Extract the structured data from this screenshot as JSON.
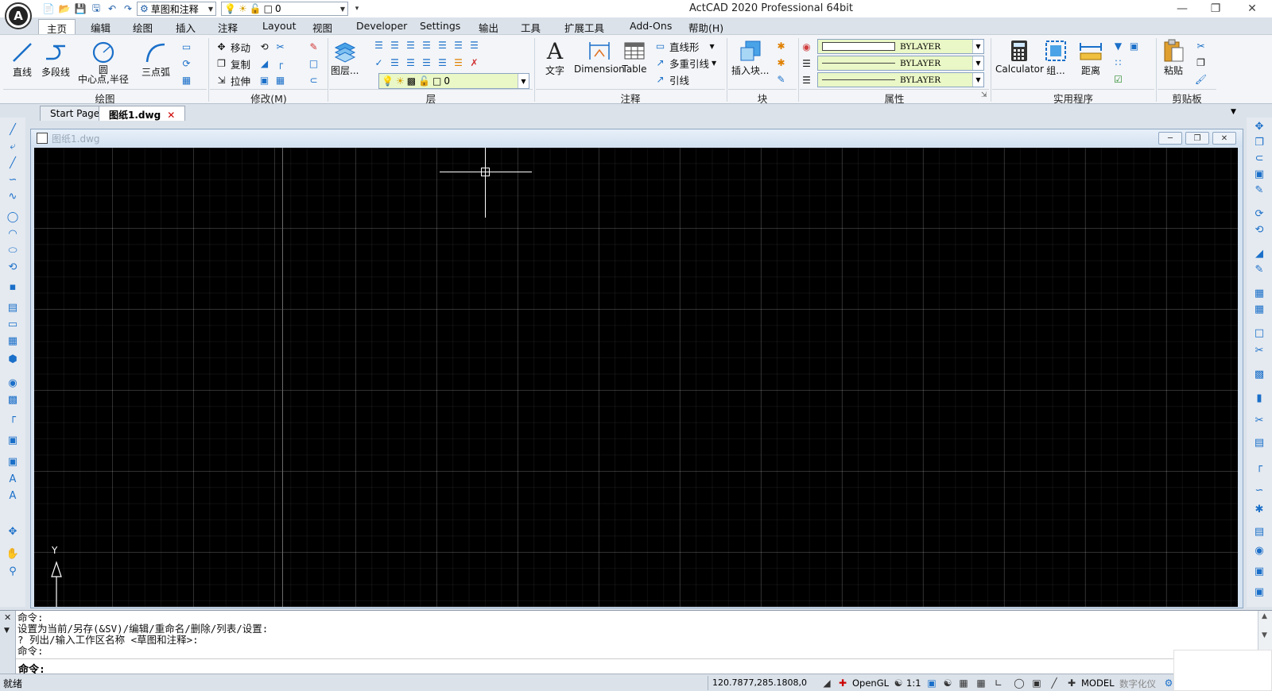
{
  "app_title": "ActCAD 2020 Professional 64bit",
  "logo_text": "A",
  "quick_access": {
    "workspace": "草图和注释",
    "layer": "0"
  },
  "menu_tabs": [
    "主页",
    "编辑",
    "绘图",
    "插入",
    "注释",
    "Layout",
    "视图",
    "Developer",
    "Settings",
    "输出",
    "工具",
    "扩展工具",
    "Add-Ons",
    "帮助(H)"
  ],
  "ribbon": {
    "draw": {
      "line": "直线",
      "polyline": "多段线",
      "circle": "圆",
      "circle_sub": "中心点,半径",
      "arc": "三点弧",
      "label": "绘图"
    },
    "modify": {
      "move": "移动",
      "copy": "复制",
      "stretch": "拉伸",
      "label": "修改(M)"
    },
    "layers": {
      "layer_props": "图层...",
      "layer_value": "0",
      "label": "层"
    },
    "annotation": {
      "text": "文字",
      "dimension": "Dimension",
      "table": "Table",
      "linear": "直线形",
      "mleader": "多重引线",
      "leader": "引线",
      "label": "注释"
    },
    "block": {
      "insert": "插入块...",
      "label": "块"
    },
    "properties": {
      "color": "BYLAYER",
      "linetype": "BYLAYER",
      "lineweight": "BYLAYER",
      "label": "属性"
    },
    "utilities": {
      "calculator": "Calculator",
      "group": "组...",
      "distance": "距离",
      "label": "实用程序"
    },
    "clipboard": {
      "paste": "粘贴",
      "label": "剪贴板"
    }
  },
  "doc_tabs": {
    "start": "Start Page",
    "active": "图纸1.dwg"
  },
  "drawing_window": {
    "title": "图纸1.dwg"
  },
  "ucs": {
    "y_label": "Y"
  },
  "command": {
    "history": [
      "命令:",
      "设置为当前/另存(&SV)/编辑/重命名/删除/列表/设置:",
      "? 列出/输入工作区名称 <草图和注释>:",
      "命令:"
    ],
    "prompt": "命令:"
  },
  "status": {
    "ready": "就绪",
    "coords": "120.7877,285.1808,0",
    "opengl": "OpenGL",
    "scale": "1:1",
    "model": "MODEL",
    "digitizer": "数字化仪"
  }
}
